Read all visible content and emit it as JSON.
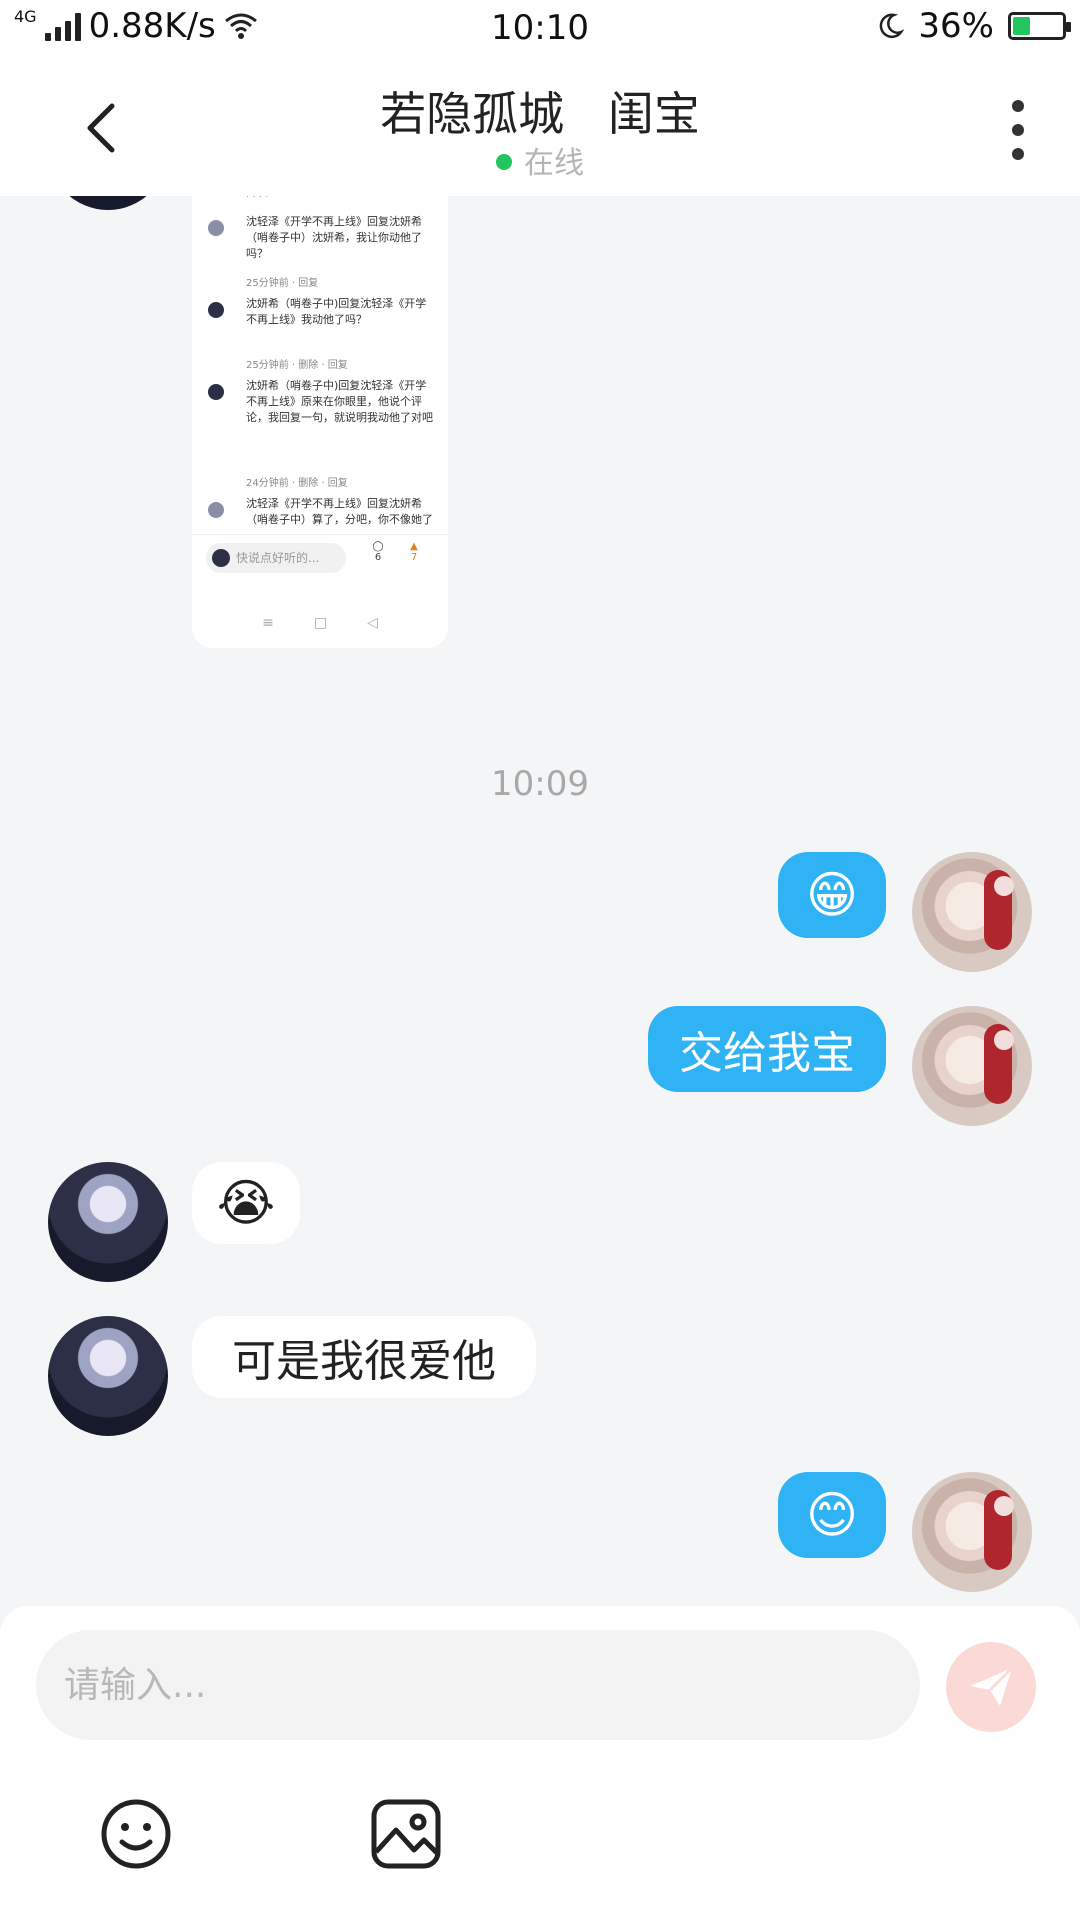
{
  "status_bar": {
    "network": "4G",
    "speed": "0.88K/s",
    "time": "10:10",
    "battery": "36%",
    "battery_level": 0.36
  },
  "header": {
    "title": "若隐孤城   闺宝",
    "status": "在线",
    "status_color": "#22c55e"
  },
  "shared_screenshot": {
    "comments": [
      {
        "text": "沈轻泽《开学不再上线》回复沈妍希（哨卷子中）沈妍希，我让你动他了吗？",
        "meta": "25分钟前 · 回复"
      },
      {
        "text": "沈妍希（哨卷子中)回复沈轻泽《开学不再上线》我动他了吗？",
        "meta": "25分钟前 · 删除 · 回复"
      },
      {
        "text": "沈妍希（哨卷子中)回复沈轻泽《开学不再上线》原来在你眼里，他说个评论，我回复一句，就说明我动他了对吧",
        "meta": "24分钟前 · 删除 · 回复"
      },
      {
        "text": "沈轻泽《开学不再上线》回复沈妍希（哨卷子中）算了，分吧，你不像她了",
        "meta": ""
      }
    ],
    "input_placeholder": "快说点好听的...",
    "comment_count": "6",
    "like_count": "7"
  },
  "chat": {
    "timestamp": "10:09",
    "messages": [
      {
        "side": "right",
        "type": "emoji",
        "content": "😁"
      },
      {
        "side": "right",
        "type": "text",
        "content": "交给我宝"
      },
      {
        "side": "left",
        "type": "emoji",
        "content": "😭"
      },
      {
        "side": "left",
        "type": "text",
        "content": "可是我很爱他"
      },
      {
        "side": "right",
        "type": "emoji",
        "content": "😊"
      }
    ]
  },
  "composer": {
    "placeholder": "请输入..."
  },
  "colors": {
    "accent_blue": "#2fb3f4",
    "send_disabled": "#fbd9d6"
  },
  "icons": {
    "back": "back-arrow-icon",
    "more": "more-vertical-icon",
    "send": "send-icon",
    "emoji": "emoji-smile-icon",
    "image": "image-icon"
  }
}
